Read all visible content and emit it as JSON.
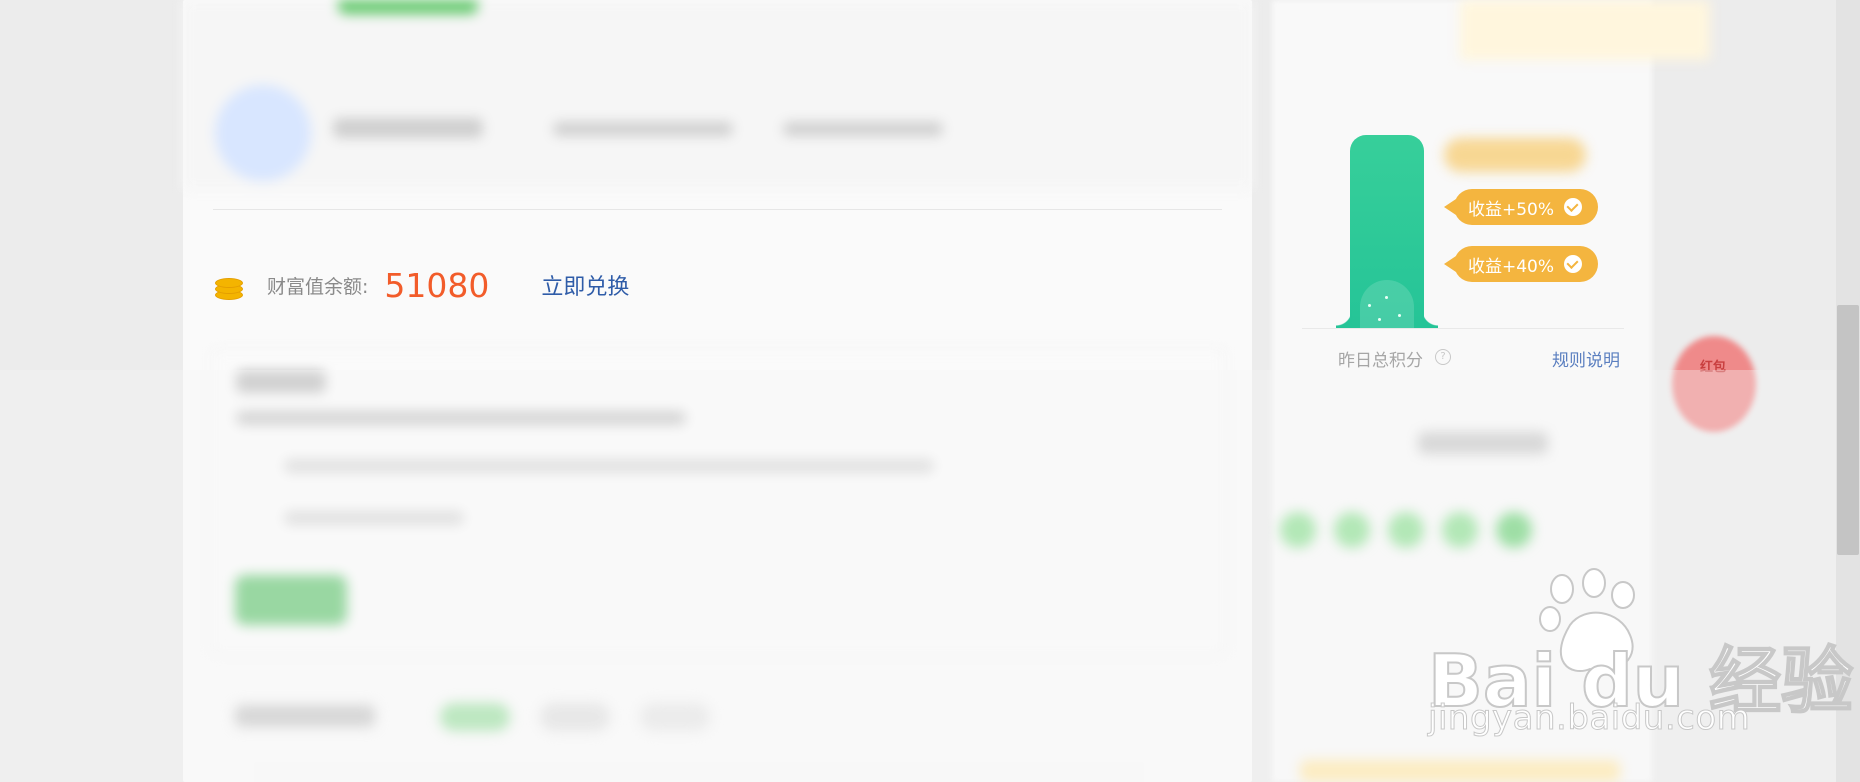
{
  "wealth": {
    "label": "财富值余额:",
    "value": "51080",
    "exchange_link": "立即兑换"
  },
  "income_badges": [
    {
      "label": "收益+50%"
    },
    {
      "label": "收益+40%"
    }
  ],
  "stats": {
    "yesterday_label": "昨日总积分",
    "rules_link": "规则说明"
  },
  "floating_button": {
    "label": "红包"
  },
  "watermark": {
    "logo_text": "Bai  du 经验",
    "url": "jingyan.baidu.com"
  },
  "colors": {
    "accent_orange": "#f25c2a",
    "link_blue": "#2f5ca8",
    "bar_green": "#2ec797",
    "badge_yellow": "#f4b53f"
  }
}
